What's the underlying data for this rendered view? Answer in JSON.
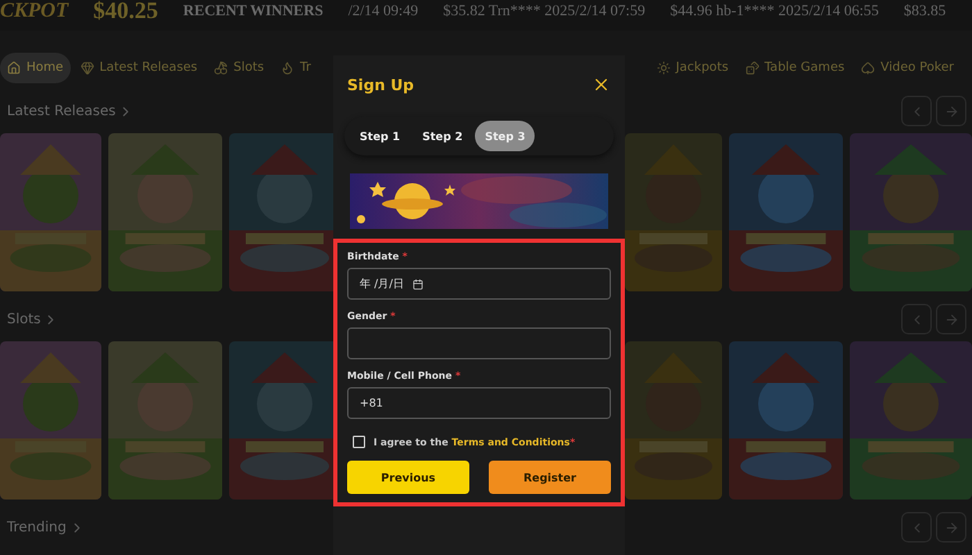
{
  "top_bar": {
    "logo_text": "CKPOT",
    "balance": "$40.25",
    "winners_label": "RECENT WINNERS",
    "winners": [
      {
        "text": "/2/14 09:49"
      },
      {
        "text": "$35.82 Trn**** 2025/2/14 07:59"
      },
      {
        "text": "$44.96 hb-1**** 2025/2/14 06:55"
      },
      {
        "text": "$83.85"
      }
    ]
  },
  "nav": {
    "left": [
      {
        "label": "Home",
        "selected": true
      },
      {
        "label": "Latest Releases",
        "selected": false
      },
      {
        "label": "Slots",
        "selected": false
      },
      {
        "label": "Tr",
        "selected": false
      }
    ],
    "right": [
      {
        "label": "Jackpots",
        "selected": false
      },
      {
        "label": "Table Games",
        "selected": false
      },
      {
        "label": "Video Poker",
        "selected": false
      }
    ]
  },
  "sections": [
    {
      "title": "Latest Releases"
    },
    {
      "title": "Slots"
    },
    {
      "title": "Trending"
    }
  ],
  "modal": {
    "title": "Sign Up",
    "steps": [
      {
        "label": "Step 1",
        "selected": false
      },
      {
        "label": "Step 2",
        "selected": false
      },
      {
        "label": "Step 3",
        "selected": true
      }
    ],
    "fields": [
      {
        "label": "Birthdate",
        "mark": "*",
        "value": "年 /月/日",
        "kind": "date"
      },
      {
        "label": "Gender",
        "mark": "*",
        "kind": "select"
      },
      {
        "label": "Mobile / Cell Phone",
        "mark": "*",
        "value": "+81",
        "kind": "text"
      }
    ],
    "agree": {
      "checked": false,
      "text": "I agree to the ",
      "link": "Terms and Conditions",
      "mark": "*"
    },
    "buttons": [
      {
        "label": "Previous",
        "kind": "secondary"
      },
      {
        "label": "Register",
        "kind": "primary"
      }
    ]
  }
}
